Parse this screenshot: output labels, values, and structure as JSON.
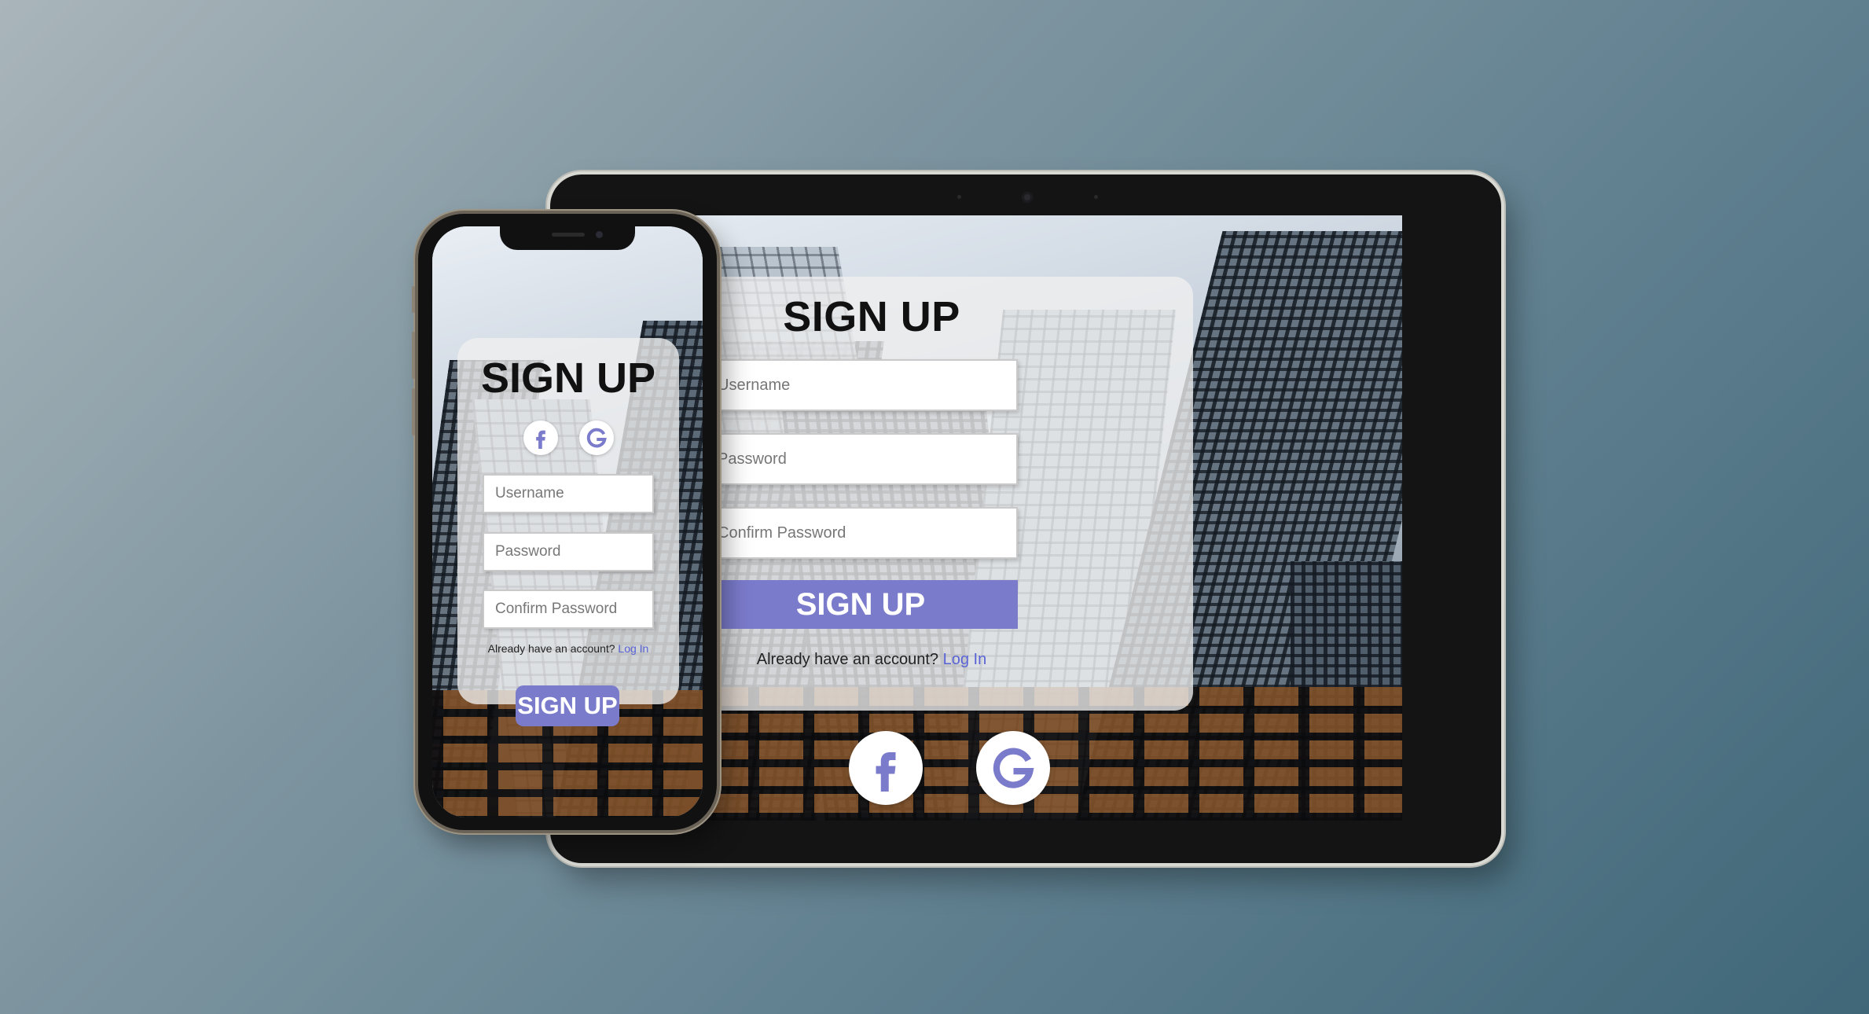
{
  "tablet": {
    "title": "SIGN UP",
    "fields": {
      "username_placeholder": "Username",
      "password_placeholder": "Password",
      "confirm_placeholder": "Confirm Password"
    },
    "submit_label": "SIGN UP",
    "login_prompt": "Already have an account?",
    "login_link": "Log In",
    "social": [
      "facebook-icon",
      "google-icon"
    ]
  },
  "phone": {
    "title": "SIGN UP",
    "fields": {
      "username_placeholder": "Username",
      "password_placeholder": "Password",
      "confirm_placeholder": "Confirm Password"
    },
    "submit_label": "SIGN UP",
    "login_prompt": "Already have an account?",
    "login_link": "Log In",
    "social": [
      "facebook-icon",
      "google-icon"
    ]
  },
  "colors": {
    "accent": "#7b7bcc",
    "link": "#5a63d6",
    "card": "rgba(240,240,240,0.78)"
  }
}
